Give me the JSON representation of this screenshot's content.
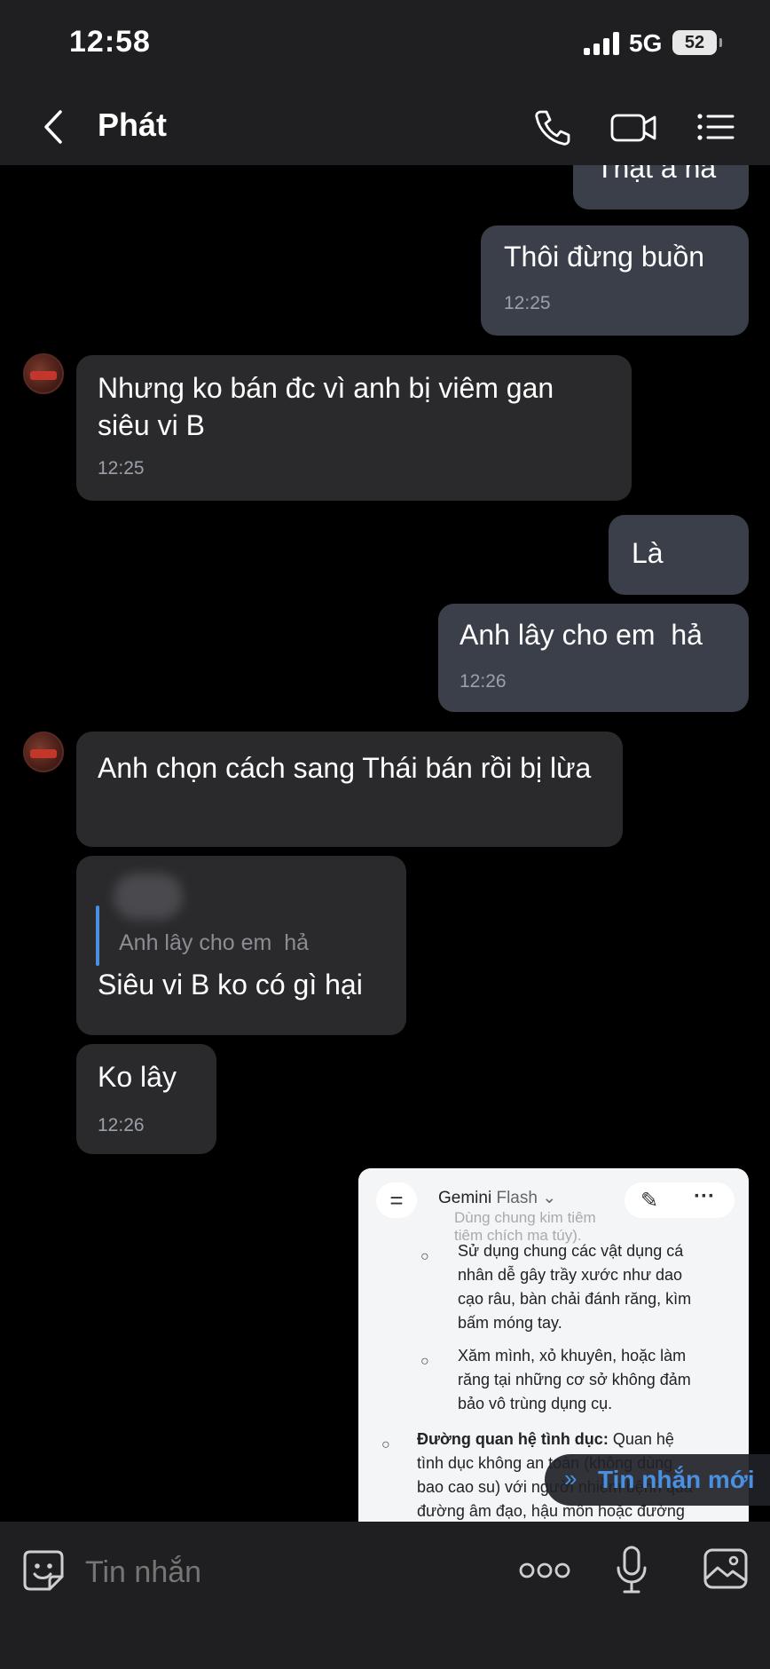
{
  "status_bar": {
    "time": "12:58",
    "network": "5G",
    "battery": "52"
  },
  "header": {
    "contact_name": "Phát"
  },
  "messages": [
    {
      "text": "Thật á hả",
      "time": ""
    },
    {
      "text": "Thôi đừng buồn",
      "time": "12:25"
    },
    {
      "text": "Nhưng ko bán đc vì anh bị viêm gan siêu vi B",
      "time": "12:25"
    },
    {
      "text": "Là",
      "time": ""
    },
    {
      "text": "Anh lây cho em  hả",
      "time": "12:26"
    },
    {
      "text": "Anh chọn cách sang Thái bán rồi bị lừa",
      "time": ""
    },
    {
      "text": "Siêu vi B ko có gì hại",
      "time": "",
      "reply_to": "Anh lây cho em  hả"
    },
    {
      "text": "Ko lây",
      "time": "12:26"
    }
  ],
  "attachment": {
    "app_title": "Gemini",
    "model": "Flash",
    "faded_lines": [
      "Dùng chung kim tiêm",
      "tiêm chích ma túy)."
    ],
    "bullets": [
      [
        "Sử dụng chung các vật dụng cá",
        "nhân dễ gây trầy xước như dao",
        "cạo râu, bàn chải đánh răng, kìm",
        "bấm móng tay."
      ],
      [
        "Xăm mình, xỏ khuyên, hoặc làm",
        "răng tại những cơ sở không đảm",
        "bảo vô trùng dụng cụ."
      ]
    ],
    "section_label": "Đường quan hệ tình dục:",
    "section_lines": [
      "Quan hệ",
      "tình dục không an toàn (không dùng",
      "bao cao su) với người nhiễm bệnh qua",
      "đường âm đạo, hậu môn hoặc đường"
    ]
  },
  "new_message_label": "Tin nhắn mới",
  "input": {
    "placeholder": "Tin nhắn"
  },
  "icons": [
    "back-icon",
    "phone-icon",
    "video-icon",
    "menu-icon",
    "sticker-icon",
    "more-icon",
    "mic-icon",
    "image-icon"
  ],
  "colors": {
    "outgoing": "#3a3f4a",
    "incoming": "#2a2a2d",
    "accent": "#4a90e2",
    "background": "#000000"
  }
}
